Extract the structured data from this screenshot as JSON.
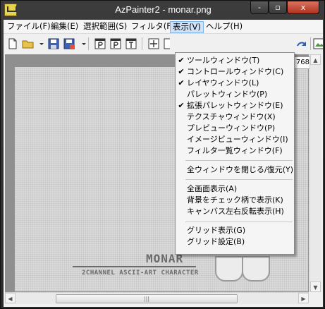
{
  "window": {
    "title": "AzPainter2 - monar.png",
    "controls": {
      "minimize": "-",
      "maximize": "▫",
      "close": "x"
    }
  },
  "menubar": [
    "ファイル(F)",
    "編集(E)",
    "選択範囲(S)",
    "フィルタ(F)",
    "表示(V)",
    "ヘルプ(H)"
  ],
  "active_menu": "表示(V)",
  "view_menu": {
    "items": [
      {
        "label": "ツールウィンドウ(T)",
        "checked": true
      },
      {
        "label": "コントロールウィンドウ(C)",
        "checked": true
      },
      {
        "label": "レイヤウィンドウ(L)",
        "checked": true
      },
      {
        "label": "パレットウィンドウ(P)",
        "checked": false
      },
      {
        "label": "拡張パレットウィンドウ(E)",
        "checked": true
      },
      {
        "label": "テクスチャウィンドウ(X)",
        "checked": false
      },
      {
        "label": "プレビューウィンドウ(P)",
        "checked": false
      },
      {
        "label": "イメージビューウィンドウ(I)",
        "checked": false
      },
      {
        "label": "フィルタ一覧ウィンドウ(F)",
        "checked": false
      },
      {
        "label": "全ウィンドウを閉じる/復元(Y)",
        "checked": false
      },
      {
        "label": "全画面表示(A)",
        "checked": false
      },
      {
        "label": "背景をチェック柄で表示(K)",
        "checked": false
      },
      {
        "label": "キャンバス左右反転表示(H)",
        "checked": false
      },
      {
        "label": "グリッド表示(G)",
        "checked": false
      },
      {
        "label": "グリッド設定(B)",
        "checked": false
      }
    ],
    "check_glyph": "✔"
  },
  "toolbar": {
    "zoom_readout": "768",
    "icons": [
      "new-file-icon",
      "open-folder-icon",
      "dropdown-icon",
      "save-icon",
      "save-as-icon",
      "dropdown-icon",
      "text-tool-p-icon",
      "text-tool-p2-icon",
      "text-tool-t-icon",
      "move-icon",
      "select-icon",
      "redo-icon",
      "image-icon"
    ]
  },
  "canvas": {
    "title": "MONAR",
    "subtitle": "2CHANNEL ASCII-ART CHARACTER"
  },
  "scrollbars": {
    "up": "▲",
    "down": "▼",
    "left": "◀",
    "right": "▶",
    "grip": "|||"
  },
  "colors": {
    "titlebar": "#2f2f2f",
    "menu_highlight": "#cfe2f7",
    "canvas_bg": "#8f8f8f"
  }
}
